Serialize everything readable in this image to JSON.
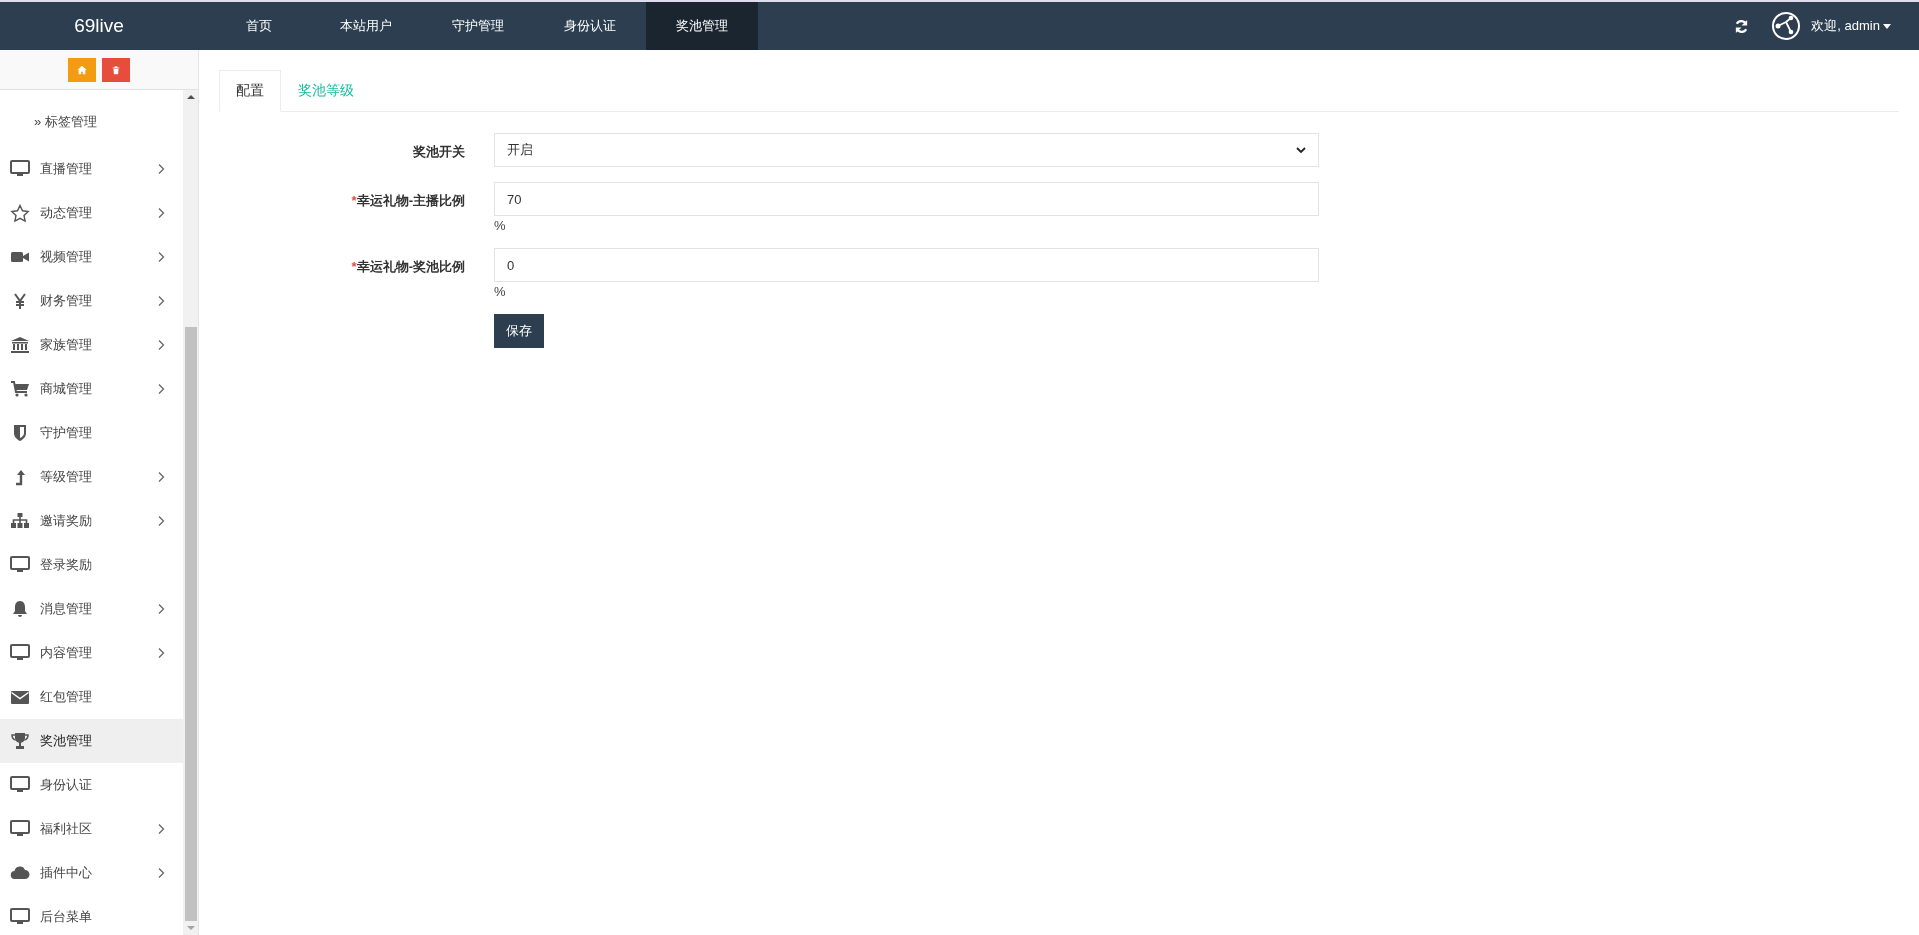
{
  "brand": "69live",
  "top_nav": [
    {
      "label": "首页",
      "selected": false
    },
    {
      "label": "本站用户",
      "selected": false
    },
    {
      "label": "守护管理",
      "selected": false
    },
    {
      "label": "身份认证",
      "selected": false
    },
    {
      "label": "奖池管理",
      "selected": true
    }
  ],
  "user_menu": {
    "label": "欢迎, admin"
  },
  "sidebar": {
    "items": [
      {
        "kind": "sub",
        "bullet": "»",
        "label": "标签管理",
        "selected": false
      },
      {
        "kind": "main",
        "label": "直播管理",
        "has_children": true,
        "selected": false
      },
      {
        "kind": "main",
        "label": "动态管理",
        "has_children": true,
        "selected": false
      },
      {
        "kind": "main",
        "label": "视频管理",
        "has_children": true,
        "selected": false
      },
      {
        "kind": "main",
        "label": "财务管理",
        "has_children": true,
        "selected": false
      },
      {
        "kind": "main",
        "label": "家族管理",
        "has_children": true,
        "selected": false
      },
      {
        "kind": "main",
        "label": "商城管理",
        "has_children": true,
        "selected": false
      },
      {
        "kind": "main",
        "label": "守护管理",
        "has_children": false,
        "selected": false
      },
      {
        "kind": "main",
        "label": "等级管理",
        "has_children": true,
        "selected": false
      },
      {
        "kind": "main",
        "label": "邀请奖励",
        "has_children": true,
        "selected": false
      },
      {
        "kind": "main",
        "label": "登录奖励",
        "has_children": false,
        "selected": false
      },
      {
        "kind": "main",
        "label": "消息管理",
        "has_children": true,
        "selected": false
      },
      {
        "kind": "main",
        "label": "内容管理",
        "has_children": true,
        "selected": false
      },
      {
        "kind": "main",
        "label": "红包管理",
        "has_children": false,
        "selected": false
      },
      {
        "kind": "main",
        "label": "奖池管理",
        "has_children": false,
        "selected": true
      },
      {
        "kind": "main",
        "label": "身份认证",
        "has_children": false,
        "selected": false
      },
      {
        "kind": "main",
        "label": "福利社区",
        "has_children": true,
        "selected": false
      },
      {
        "kind": "main",
        "label": "插件中心",
        "has_children": true,
        "selected": false
      },
      {
        "kind": "main",
        "label": "后台菜单",
        "has_children": false,
        "selected": false
      }
    ]
  },
  "tabs": [
    {
      "label": "配置",
      "selected": true
    },
    {
      "label": "奖池等级",
      "selected": false
    }
  ],
  "form": {
    "fields": [
      {
        "kind": "select",
        "label": "奖池开关",
        "value": "开启"
      },
      {
        "kind": "input",
        "required_mark": "*",
        "label": "幸运礼物-主播比例",
        "value": "70",
        "suffix": "%"
      },
      {
        "kind": "input",
        "required_mark": "*",
        "label": "幸运礼物-奖池比例",
        "value": "0",
        "suffix": "%"
      }
    ],
    "submit": "保存"
  }
}
